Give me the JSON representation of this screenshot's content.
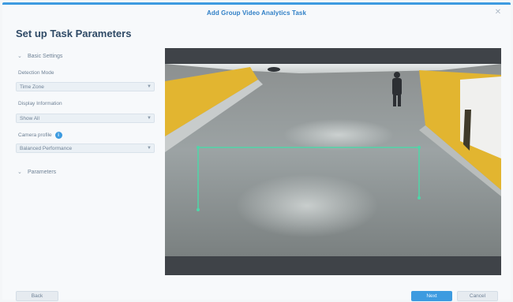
{
  "window": {
    "title": "Add Group Video Analytics Task",
    "close_icon": "close-icon"
  },
  "page": {
    "title": "Set up Task Parameters"
  },
  "basic_settings": {
    "header": "Basic Settings",
    "detection_label": "Detection Mode",
    "detection_value": "Time Zone",
    "display_label": "Display Information",
    "display_value": "Show All",
    "profile_label": "Camera profile",
    "profile_value": "Balanced Performance"
  },
  "parameters": {
    "header": "Parameters"
  },
  "footer": {
    "back_label": "Back",
    "next_label": "Next",
    "cancel_label": "Cancel"
  },
  "colors": {
    "accent": "#3d9be0",
    "detection_zone": "#4fd6a8",
    "wall_yellow": "#e2b530"
  }
}
